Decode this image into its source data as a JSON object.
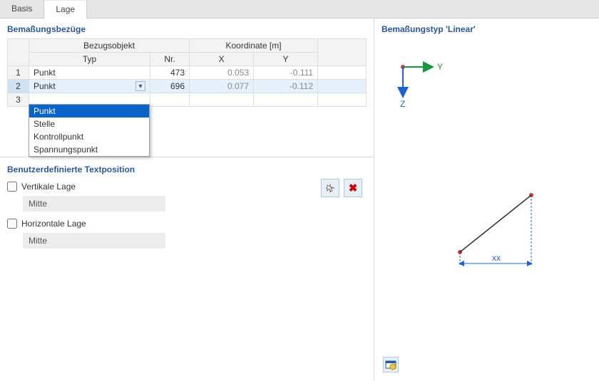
{
  "tabs": {
    "basis": "Basis",
    "lage": "Lage"
  },
  "sections": {
    "refs_title": "Bemaßungsbezüge",
    "textpos_title": "Benutzerdefinierte Textposition",
    "preview_title": "Bemaßungstyp 'Linear'"
  },
  "grid": {
    "header_obj": "Bezugsobjekt",
    "header_coord": "Koordinate [m]",
    "col_typ": "Typ",
    "col_nr": "Nr.",
    "col_x": "X",
    "col_y": "Y",
    "rows": [
      {
        "idx": "1",
        "typ": "Punkt",
        "nr": "473",
        "x": "0.053",
        "y": "-0.111"
      },
      {
        "idx": "2",
        "typ": "Punkt",
        "nr": "696",
        "x": "0.077",
        "y": "-0.112"
      },
      {
        "idx": "3",
        "typ": "",
        "nr": "",
        "x": "",
        "y": ""
      }
    ]
  },
  "dropdown": {
    "options": [
      "Punkt",
      "Stelle",
      "Kontrollpunkt",
      "Spannungspunkt"
    ],
    "selected": "Punkt"
  },
  "textpos": {
    "vert_label": "Vertikale Lage",
    "vert_value": "Mitte",
    "horz_label": "Horizontale Lage",
    "horz_value": "Mitte"
  },
  "preview": {
    "axis_y": "Y",
    "axis_z": "Z",
    "dim_label": "xx"
  },
  "icons": {
    "pick": "⤢",
    "delete": "✖",
    "view": "🖼"
  }
}
